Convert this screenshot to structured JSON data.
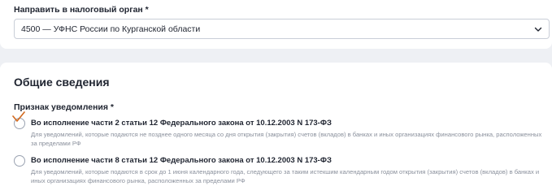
{
  "tax_authority": {
    "label": "Направить в налоговый орган *",
    "selected_value": "4500 — УФНС России по Курганской области"
  },
  "general_info": {
    "title": "Общие сведения",
    "notification_sign": {
      "label": "Признак уведомления *",
      "options": [
        {
          "title": "Во исполнение части 2 статьи 12 Федерального закона от 10.12.2003 N 173-ФЗ",
          "description": "Для уведомлений, которые подаются не позднее одного месяца со дня открытия (закрытия) счетов (вкладов) в банках и иных организациях финансового рынка, расположенных за пределами РФ",
          "checked": true
        },
        {
          "title": "Во исполнение части 8 статьи 12 Федерального закона от 10.12.2003 N 173-ФЗ",
          "description": "Для уведомлений, которые подаются в срок до 1 июня календарного года, следующего за таким истекшим календарным годом открытия (закрытия) счетов (вкладов) в банках и иных организациях финансового рынка, расположенных за пределами РФ",
          "checked": false
        }
      ]
    }
  },
  "icons": {
    "chevron": "chevron-down-icon",
    "checkmark": "checkmark-icon"
  },
  "colors": {
    "page_background": "#eef0f4",
    "card_background": "#ffffff",
    "text": "#1f2430",
    "muted_text": "#8a909c",
    "border": "#c9ced8",
    "checkmark": "#d2691e"
  }
}
